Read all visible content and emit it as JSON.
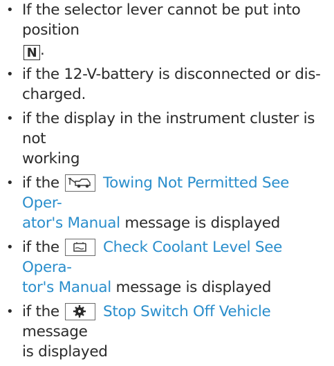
{
  "items": [
    {
      "line1": "If the selector lever cannot be put into position",
      "key": "N",
      "tail": "."
    },
    {
      "line1": "if the 12-V-battery is disconnected or dis-",
      "line2": "charged."
    },
    {
      "line1": "if the display in the instrument cluster is not",
      "line2": "working"
    },
    {
      "pre": "if the",
      "icon": "towing-icon",
      "msg1": "Towing Not Permitted See Oper-",
      "msg2": "ator's Manual",
      "post": "message is displayed"
    },
    {
      "pre": "if the",
      "icon": "coolant-level-icon",
      "msg1": "Check Coolant Level See Opera-",
      "msg2": "tor's Manual",
      "post": "message is displayed"
    },
    {
      "pre": "if the",
      "icon": "engine-stop-icon",
      "msg1": "Stop Switch Off Vehicle",
      "post": "message",
      "line2": "is displayed"
    }
  ],
  "colors": {
    "text": "#2b2b2b",
    "message": "#2a8ecc"
  }
}
